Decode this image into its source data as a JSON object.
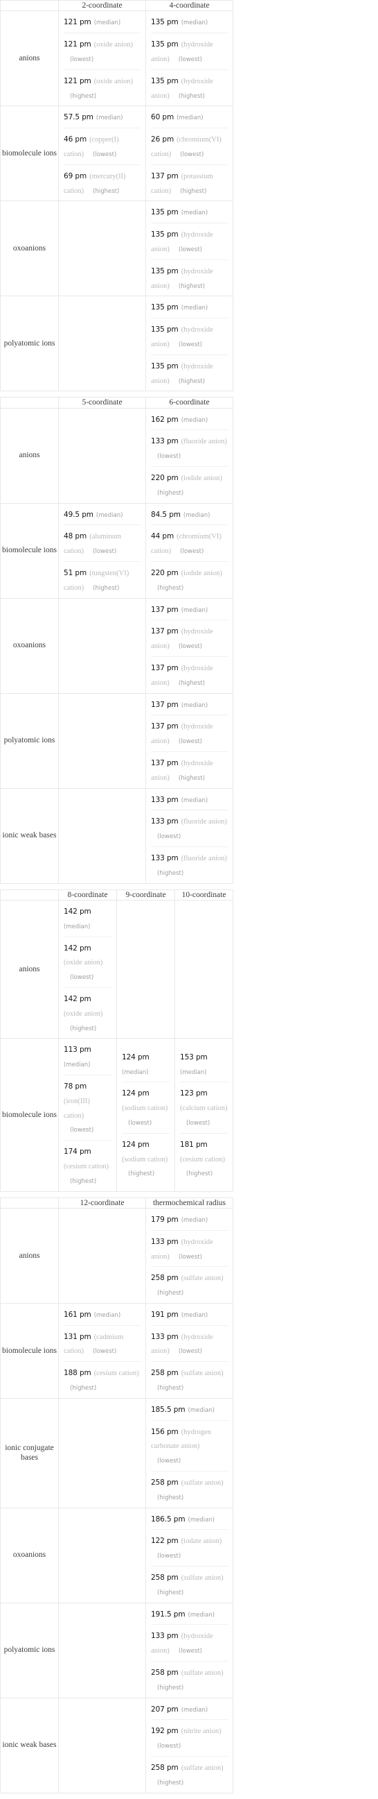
{
  "units": "pm",
  "tables": [
    {
      "id": "table-coord-2-4",
      "columns": [
        "",
        "2-coordinate",
        "4-coordinate"
      ],
      "rows": [
        {
          "label": "anions",
          "cells": [
            [
              {
                "value": "121 pm",
                "species": "",
                "tag": "(median)"
              },
              {
                "value": "121 pm",
                "species": "(oxide anion)",
                "tag": "(lowest)"
              },
              {
                "value": "121 pm",
                "species": "(oxide anion)",
                "tag": "(highest)"
              }
            ],
            [
              {
                "value": "135 pm",
                "species": "",
                "tag": "(median)"
              },
              {
                "value": "135 pm",
                "species": "(hydroxide anion)",
                "tag": "(lowest)"
              },
              {
                "value": "135 pm",
                "species": "(hydroxide anion)",
                "tag": "(highest)"
              }
            ]
          ]
        },
        {
          "label": "biomolecule ions",
          "cells": [
            [
              {
                "value": "57.5 pm",
                "species": "",
                "tag": "(median)"
              },
              {
                "value": "46 pm",
                "species": "(copper(I) cation)",
                "tag": "(lowest)"
              },
              {
                "value": "69 pm",
                "species": "(mercury(II) cation)",
                "tag": "(highest)"
              }
            ],
            [
              {
                "value": "60 pm",
                "species": "",
                "tag": "(median)"
              },
              {
                "value": "26 pm",
                "species": "(chromium(VI) cation)",
                "tag": "(lowest)"
              },
              {
                "value": "137 pm",
                "species": "(potassium cation)",
                "tag": "(highest)"
              }
            ]
          ]
        },
        {
          "label": "oxoanions",
          "cells": [
            [],
            [
              {
                "value": "135 pm",
                "species": "",
                "tag": "(median)"
              },
              {
                "value": "135 pm",
                "species": "(hydroxide anion)",
                "tag": "(lowest)"
              },
              {
                "value": "135 pm",
                "species": "(hydroxide anion)",
                "tag": "(highest)"
              }
            ]
          ]
        },
        {
          "label": "polyatomic ions",
          "cells": [
            [],
            [
              {
                "value": "135 pm",
                "species": "",
                "tag": "(median)"
              },
              {
                "value": "135 pm",
                "species": "(hydroxide anion)",
                "tag": "(lowest)"
              },
              {
                "value": "135 pm",
                "species": "(hydroxide anion)",
                "tag": "(highest)"
              }
            ]
          ]
        }
      ]
    },
    {
      "id": "table-coord-5-6",
      "columns": [
        "",
        "5-coordinate",
        "6-coordinate"
      ],
      "rows": [
        {
          "label": "anions",
          "cells": [
            [],
            [
              {
                "value": "162 pm",
                "species": "",
                "tag": "(median)"
              },
              {
                "value": "133 pm",
                "species": "(fluoride anion)",
                "tag": "(lowest)"
              },
              {
                "value": "220 pm",
                "species": "(iodide anion)",
                "tag": "(highest)"
              }
            ]
          ]
        },
        {
          "label": "biomolecule ions",
          "cells": [
            [
              {
                "value": "49.5 pm",
                "species": "",
                "tag": "(median)"
              },
              {
                "value": "48 pm",
                "species": "(aluminum cation)",
                "tag": "(lowest)"
              },
              {
                "value": "51 pm",
                "species": "(tungsten(VI) cation)",
                "tag": "(highest)"
              }
            ],
            [
              {
                "value": "84.5 pm",
                "species": "",
                "tag": "(median)"
              },
              {
                "value": "44 pm",
                "species": "(chromium(VI) cation)",
                "tag": "(lowest)"
              },
              {
                "value": "220 pm",
                "species": "(iodide anion)",
                "tag": "(highest)"
              }
            ]
          ]
        },
        {
          "label": "oxoanions",
          "cells": [
            [],
            [
              {
                "value": "137 pm",
                "species": "",
                "tag": "(median)"
              },
              {
                "value": "137 pm",
                "species": "(hydroxide anion)",
                "tag": "(lowest)"
              },
              {
                "value": "137 pm",
                "species": "(hydroxide anion)",
                "tag": "(highest)"
              }
            ]
          ]
        },
        {
          "label": "polyatomic ions",
          "cells": [
            [],
            [
              {
                "value": "137 pm",
                "species": "",
                "tag": "(median)"
              },
              {
                "value": "137 pm",
                "species": "(hydroxide anion)",
                "tag": "(lowest)"
              },
              {
                "value": "137 pm",
                "species": "(hydroxide anion)",
                "tag": "(highest)"
              }
            ]
          ]
        },
        {
          "label": "ionic weak bases",
          "cells": [
            [],
            [
              {
                "value": "133 pm",
                "species": "",
                "tag": "(median)"
              },
              {
                "value": "133 pm",
                "species": "(fluoride anion)",
                "tag": "(lowest)"
              },
              {
                "value": "133 pm",
                "species": "(fluoride anion)",
                "tag": "(highest)"
              }
            ]
          ]
        }
      ]
    },
    {
      "id": "table-coord-8-9-10",
      "columns": [
        "",
        "8-coordinate",
        "9-coordinate",
        "10-coordinate"
      ],
      "rows": [
        {
          "label": "anions",
          "cells": [
            [
              {
                "value": "142 pm",
                "species": "",
                "tag": "(median)"
              },
              {
                "value": "142 pm",
                "species": "(oxide anion)",
                "tag": "(lowest)"
              },
              {
                "value": "142 pm",
                "species": "(oxide anion)",
                "tag": "(highest)"
              }
            ],
            [],
            []
          ]
        },
        {
          "label": "biomolecule ions",
          "cells": [
            [
              {
                "value": "113 pm",
                "species": "",
                "tag": "(median)"
              },
              {
                "value": "78 pm",
                "species": "(iron(III) cation)",
                "tag": "(lowest)"
              },
              {
                "value": "174 pm",
                "species": "(cesium cation)",
                "tag": "(highest)"
              }
            ],
            [
              {
                "value": "124 pm",
                "species": "",
                "tag": "(median)"
              },
              {
                "value": "124 pm",
                "species": "(sodium cation)",
                "tag": "(lowest)"
              },
              {
                "value": "124 pm",
                "species": "(sodium cation)",
                "tag": "(highest)"
              }
            ],
            [
              {
                "value": "153 pm",
                "species": "",
                "tag": "(median)"
              },
              {
                "value": "123 pm",
                "species": "(calcium cation)",
                "tag": "(lowest)"
              },
              {
                "value": "181 pm",
                "species": "(cesium cation)",
                "tag": "(highest)"
              }
            ]
          ]
        }
      ]
    },
    {
      "id": "table-coord-12-thermochemical",
      "columns": [
        "",
        "12-coordinate",
        "thermochemical radius"
      ],
      "rows": [
        {
          "label": "anions",
          "cells": [
            [],
            [
              {
                "value": "179 pm",
                "species": "",
                "tag": "(median)"
              },
              {
                "value": "133 pm",
                "species": "(hydroxide anion)",
                "tag": "(lowest)"
              },
              {
                "value": "258 pm",
                "species": "(sulfate anion)",
                "tag": "(highest)"
              }
            ]
          ]
        },
        {
          "label": "biomolecule ions",
          "cells": [
            [
              {
                "value": "161 pm",
                "species": "",
                "tag": "(median)"
              },
              {
                "value": "131 pm",
                "species": "(cadmium cation)",
                "tag": "(lowest)"
              },
              {
                "value": "188 pm",
                "species": "(cesium cation)",
                "tag": "(highest)"
              }
            ],
            [
              {
                "value": "191 pm",
                "species": "",
                "tag": "(median)"
              },
              {
                "value": "133 pm",
                "species": "(hydroxide anion)",
                "tag": "(lowest)"
              },
              {
                "value": "258 pm",
                "species": "(sulfate anion)",
                "tag": "(highest)"
              }
            ]
          ]
        },
        {
          "label": "ionic conjugate bases",
          "cells": [
            [],
            [
              {
                "value": "185.5 pm",
                "species": "",
                "tag": "(median)"
              },
              {
                "value": "156 pm",
                "species": "(hydrogen carbonate anion)",
                "tag": "(lowest)"
              },
              {
                "value": "258 pm",
                "species": "(sulfate anion)",
                "tag": "(highest)"
              }
            ]
          ]
        },
        {
          "label": "oxoanions",
          "cells": [
            [],
            [
              {
                "value": "186.5 pm",
                "species": "",
                "tag": "(median)"
              },
              {
                "value": "122 pm",
                "species": "(iodate anion)",
                "tag": "(lowest)"
              },
              {
                "value": "258 pm",
                "species": "(sulfate anion)",
                "tag": "(highest)"
              }
            ]
          ]
        },
        {
          "label": "polyatomic ions",
          "cells": [
            [],
            [
              {
                "value": "191.5 pm",
                "species": "",
                "tag": "(median)"
              },
              {
                "value": "133 pm",
                "species": "(hydroxide anion)",
                "tag": "(lowest)"
              },
              {
                "value": "258 pm",
                "species": "(sulfate anion)",
                "tag": "(highest)"
              }
            ]
          ]
        },
        {
          "label": "ionic weak bases",
          "cells": [
            [],
            [
              {
                "value": "207 pm",
                "species": "",
                "tag": "(median)"
              },
              {
                "value": "192 pm",
                "species": "(nitrite anion)",
                "tag": "(lowest)"
              },
              {
                "value": "258 pm",
                "species": "(sulfate anion)",
                "tag": "(highest)"
              }
            ]
          ]
        }
      ]
    }
  ]
}
